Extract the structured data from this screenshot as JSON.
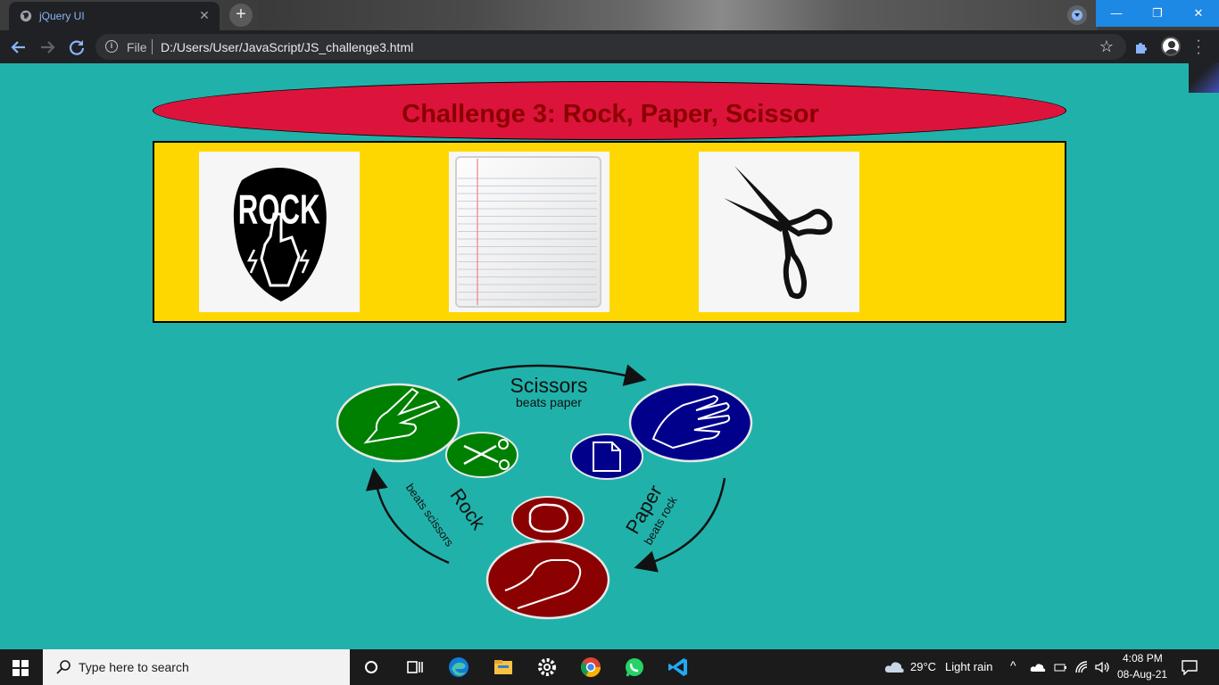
{
  "browser": {
    "tab_title": "jQuery UI",
    "tab_close": "✕",
    "new_tab": "+",
    "url_scheme_label": "File",
    "url": "D:/Users/User/JavaScript/JS_challenge3.html",
    "window_controls": {
      "minimize": "—",
      "maximize": "❐",
      "close": "✕"
    }
  },
  "page": {
    "heading": "Challenge 3: Rock, Paper, Scissor",
    "colors": {
      "background": "#20b2aa",
      "heading_fill": "#dc143c",
      "heading_text": "#8b0000",
      "box_fill": "#ffd700"
    },
    "choices": [
      {
        "id": "rock",
        "image_text": "ROCK",
        "icon": "rock-hand-icon"
      },
      {
        "id": "paper",
        "icon": "lined-paper-icon"
      },
      {
        "id": "scissors",
        "icon": "scissors-icon"
      }
    ],
    "rules": {
      "scissors": {
        "title": "Scissors",
        "subtitle": "beats paper",
        "color": "#008000"
      },
      "paper": {
        "title": "Paper",
        "subtitle": "beats rock",
        "color": "#00008b"
      },
      "rock": {
        "title": "Rock",
        "subtitle": "beats scissors",
        "color": "#8b0000"
      }
    }
  },
  "taskbar": {
    "search_placeholder": "Type here to search",
    "apps": [
      "cortana-icon",
      "task-view-icon",
      "edge-icon",
      "file-explorer-icon",
      "settings-icon",
      "chrome-icon",
      "whatsapp-icon",
      "vscode-icon"
    ],
    "weather_temp": "29°C",
    "weather_desc": "Light rain",
    "time": "4:08 PM",
    "date": "08-Aug-21"
  }
}
